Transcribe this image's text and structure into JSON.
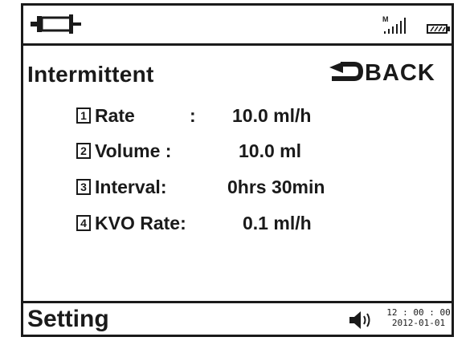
{
  "icons": {
    "syringe": "syringe-icon",
    "signal": "signal-strength-icon",
    "battery": "battery-icon",
    "back_arrow": "u-turn-arrow-icon",
    "speaker": "speaker-volume-icon"
  },
  "status_bar": {
    "signal_mode": "M",
    "signal_level": "6 of 6"
  },
  "header": {
    "title": "Intermittent",
    "back_label": "BACK"
  },
  "parameters": [
    {
      "number": "1",
      "label": "Rate",
      "separator": ":",
      "value": "10.0 ml/h"
    },
    {
      "number": "2",
      "label": "Volume :",
      "value": "10.0 ml"
    },
    {
      "number": "3",
      "label": "Interval:",
      "value": "0hrs 30min"
    },
    {
      "number": "4",
      "label": "KVO Rate:",
      "value": "0.1 ml/h"
    }
  ],
  "footer": {
    "title": "Setting",
    "time": "12 : 00 : 00",
    "date": "2012-01-01"
  },
  "colors": {
    "foreground": "#1a1a1a",
    "background": "#ffffff"
  }
}
